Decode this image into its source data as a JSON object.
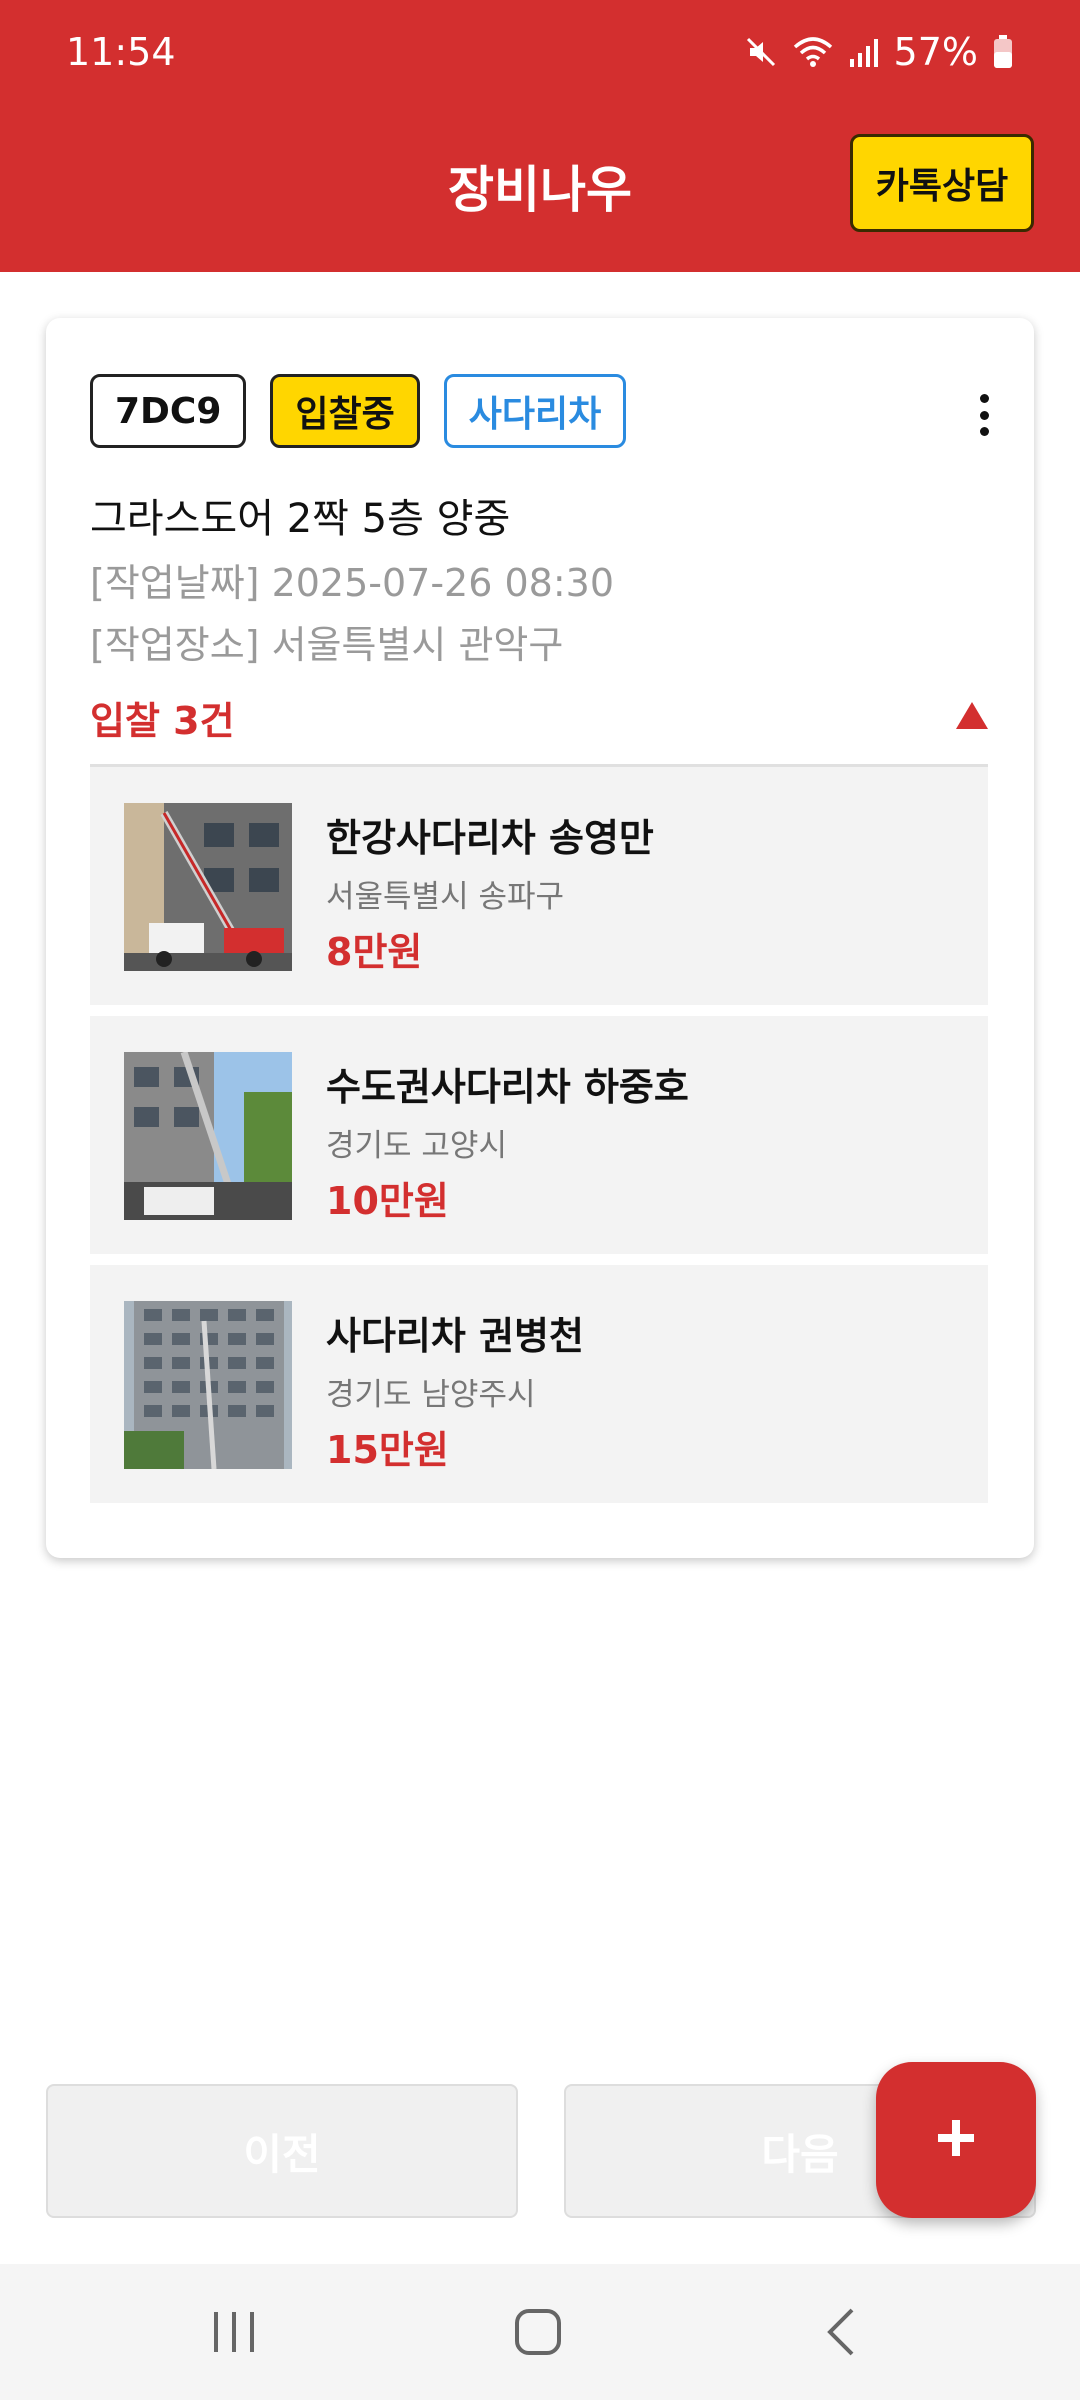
{
  "status_bar": {
    "time": "11:54",
    "battery": "57%"
  },
  "header": {
    "title": "장비나우",
    "kakao_label": "카톡상담"
  },
  "job": {
    "code_tag": "7DC9",
    "status_tag": "입찰중",
    "type_tag": "사다리차",
    "title": "그라스도어 2짝 5층 양중",
    "date": "[작업날짜] 2025-07-26 08:30",
    "place": "[작업장소] 서울특별시 관악구",
    "bid_count": "입찰 3건"
  },
  "bids": [
    {
      "name": "한강사다리차 송영만",
      "region": "서울특별시 송파구",
      "price": "8만원"
    },
    {
      "name": "수도권사다리차 하중호",
      "region": "경기도 고양시",
      "price": "10만원"
    },
    {
      "name": "사다리차 권병천",
      "region": "경기도 남양주시",
      "price": "15만원"
    }
  ],
  "footer": {
    "prev_label": "이전",
    "next_label": "다음"
  },
  "colors": {
    "brand": "#d32f2f",
    "accent_yellow": "#ffd600",
    "tag_blue": "#2a8be0"
  },
  "icons": [
    "mute-icon",
    "wifi-icon",
    "signal-icon",
    "battery-icon",
    "more-vert-icon",
    "collapse-up-icon",
    "plus-icon",
    "recents-icon",
    "home-icon",
    "back-icon"
  ]
}
